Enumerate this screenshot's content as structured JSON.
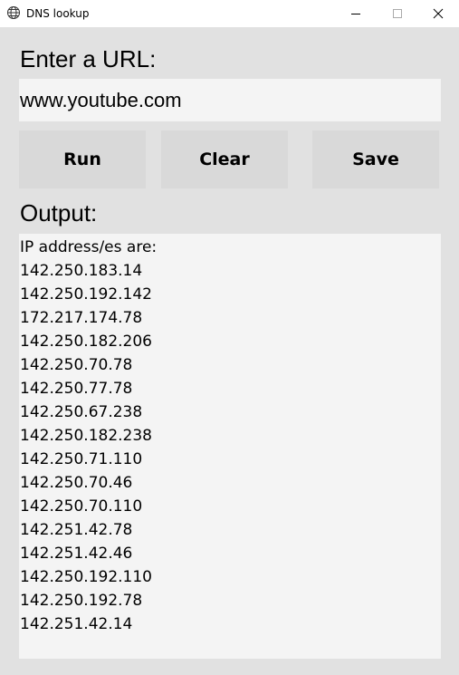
{
  "window": {
    "title": "DNS lookup",
    "icon": "globe-icon"
  },
  "url_section": {
    "label": "Enter a URL:",
    "value": "www.youtube.com"
  },
  "buttons": {
    "run": "Run",
    "clear": "Clear",
    "save": "Save"
  },
  "output": {
    "label": "Output:",
    "lines": [
      "IP address/es are:",
      "142.250.183.14",
      "142.250.192.142",
      "172.217.174.78",
      "142.250.182.206",
      "142.250.70.78",
      "142.250.77.78",
      "142.250.67.238",
      "142.250.182.238",
      "142.250.71.110",
      "142.250.70.46",
      "142.250.70.110",
      "142.251.42.78",
      "142.251.42.46",
      "142.250.192.110",
      "142.250.192.78",
      "142.251.42.14"
    ]
  }
}
